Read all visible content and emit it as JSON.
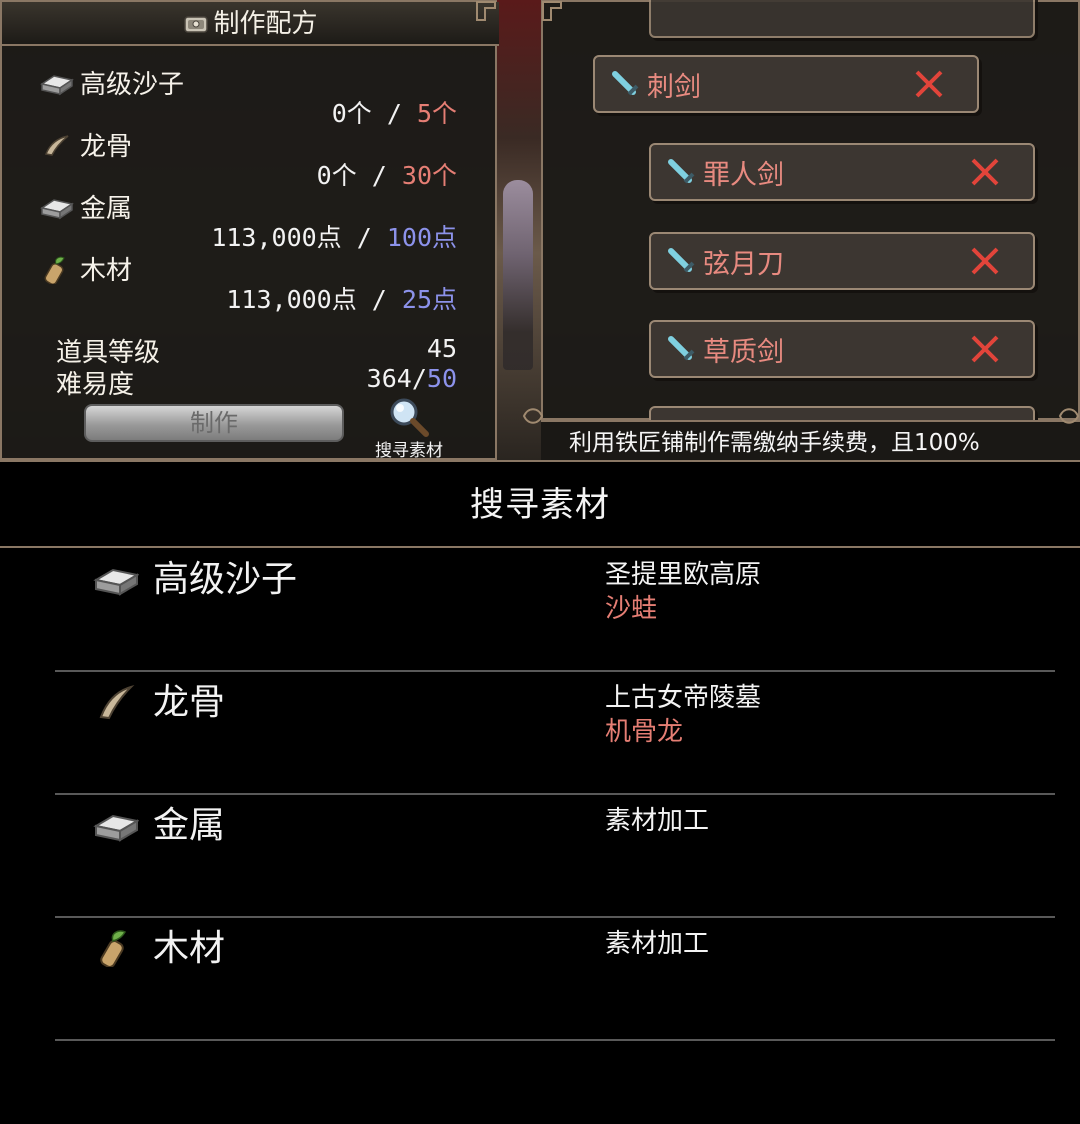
{
  "recipe_panel": {
    "title": "制作配方",
    "materials": [
      {
        "name": "高级沙子",
        "have": "0个",
        "sep": " / ",
        "need": "5个",
        "need_color": "red",
        "icon": "ingot-icon"
      },
      {
        "name": "龙骨",
        "have": "0个",
        "sep": " / ",
        "need": "30个",
        "need_color": "red",
        "icon": "bone-icon"
      },
      {
        "name": "金属",
        "have": "113,000点",
        "sep": " / ",
        "need": "100点",
        "need_color": "blue",
        "icon": "ingot-icon"
      },
      {
        "name": "木材",
        "have": "113,000点",
        "sep": " / ",
        "need": "25点",
        "need_color": "blue",
        "icon": "wood-icon"
      }
    ],
    "item_level_label": "道具等级",
    "item_level_value": "45",
    "difficulty_label": "难易度",
    "difficulty_current": "364/",
    "difficulty_max": "50",
    "craft_button": "制作",
    "search_button": "搜寻素材"
  },
  "weapon_list": [
    {
      "name": "刺剑"
    },
    {
      "name": "罪人剑"
    },
    {
      "name": "弦月刀"
    },
    {
      "name": "草质剑"
    }
  ],
  "notice": "利用铁匠铺制作需缴纳手续费，且100%",
  "search_panel": {
    "title": "搜寻素材",
    "rows": [
      {
        "name": "高级沙子",
        "location": "圣提里欧高原",
        "source": "沙蛙",
        "icon": "ingot-icon"
      },
      {
        "name": "龙骨",
        "location": "上古女帝陵墓",
        "source": "机骨龙",
        "icon": "bone-icon"
      },
      {
        "name": "金属",
        "location": "素材加工",
        "source": "",
        "icon": "ingot-icon"
      },
      {
        "name": "木材",
        "location": "素材加工",
        "source": "",
        "icon": "wood-icon"
      }
    ]
  },
  "colors": {
    "need_red": "#e57e74",
    "need_blue": "#8c92ea",
    "weapon_name": "#e88a80",
    "close_x": "#e2443a"
  }
}
